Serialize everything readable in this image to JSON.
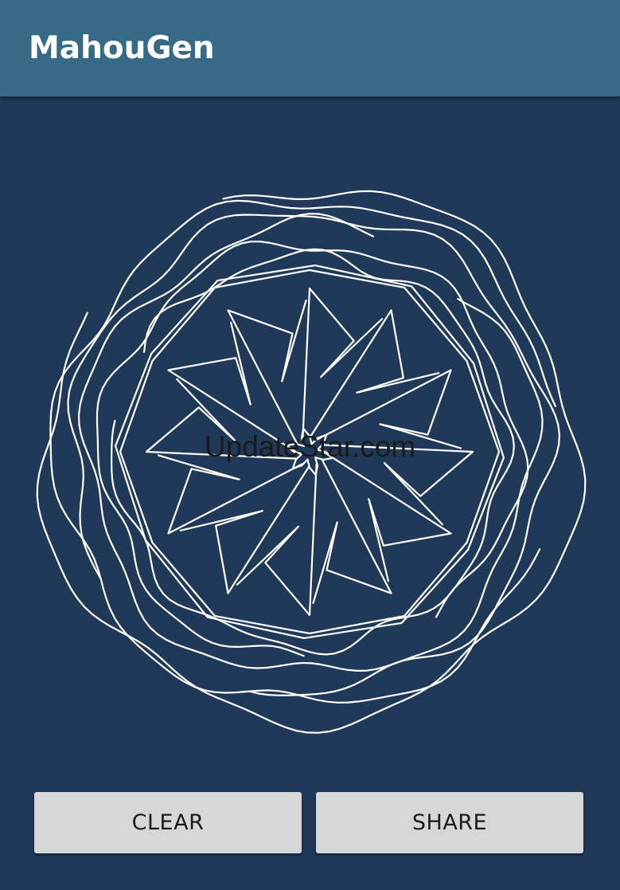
{
  "app_bar": {
    "title": "MahouGen",
    "color": "#366a87"
  },
  "canvas": {
    "background_color": "#203959",
    "stroke_color": "#ffffff",
    "watermark": "UpdateStar.com"
  },
  "actions": {
    "clear_label": "CLEAR",
    "share_label": "SHARE",
    "button_color": "#d7d7d7"
  }
}
